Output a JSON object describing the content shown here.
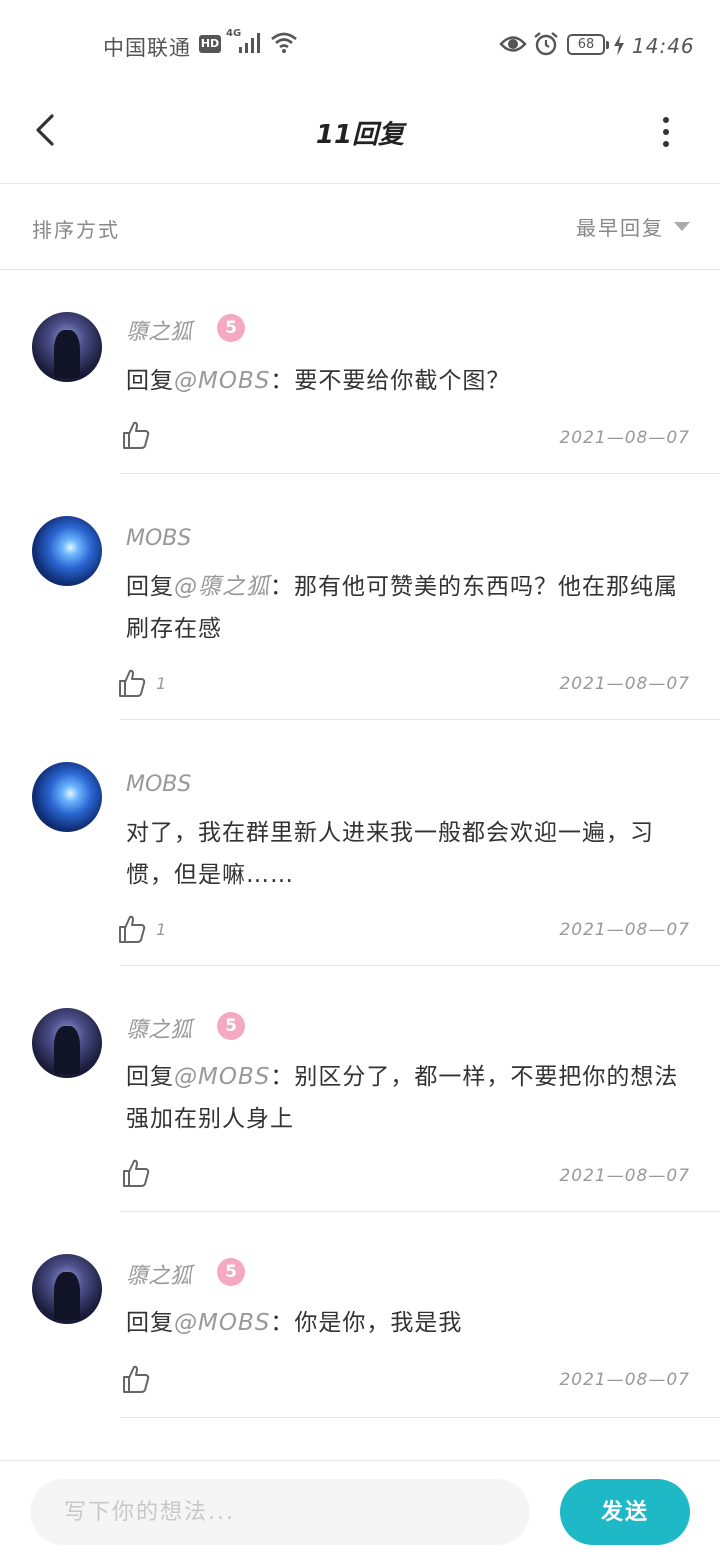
{
  "status_bar": {
    "carrier": "中国联通",
    "hd": "HD",
    "network": "4G",
    "battery": "68",
    "time": "14:46"
  },
  "header": {
    "title": "11回复"
  },
  "sort": {
    "label": "排序方式",
    "selected": "最早回复"
  },
  "replies": [
    {
      "user": "隳之狐",
      "level": "5",
      "prefix": "回复",
      "mention": "@MOBS",
      "text": "：要不要给你截个图？",
      "likes": "",
      "date": "2021—08—07"
    },
    {
      "user": "MOBS",
      "level": "",
      "prefix": "回复",
      "mention": "@隳之狐",
      "text": "：那有他可赞美的东西吗？他在那纯属刷存在感",
      "likes": "1",
      "date": "2021—08—07"
    },
    {
      "user": "MOBS",
      "level": "",
      "prefix": "",
      "mention": "",
      "text": "对了，我在群里新人进来我一般都会欢迎一遍，习惯，但是嘛……",
      "likes": "1",
      "date": "2021—08—07"
    },
    {
      "user": "隳之狐",
      "level": "5",
      "prefix": "回复",
      "mention": "@MOBS",
      "text": "：别区分了，都一样，不要把你的想法强加在别人身上",
      "likes": "",
      "date": "2021—08—07"
    },
    {
      "user": "隳之狐",
      "level": "5",
      "prefix": "回复",
      "mention": "@MOBS",
      "text": "：你是你，我是我",
      "likes": "",
      "date": "2021—08—07"
    }
  ],
  "composer": {
    "placeholder": "写下你的想法...",
    "send_label": "发送"
  }
}
